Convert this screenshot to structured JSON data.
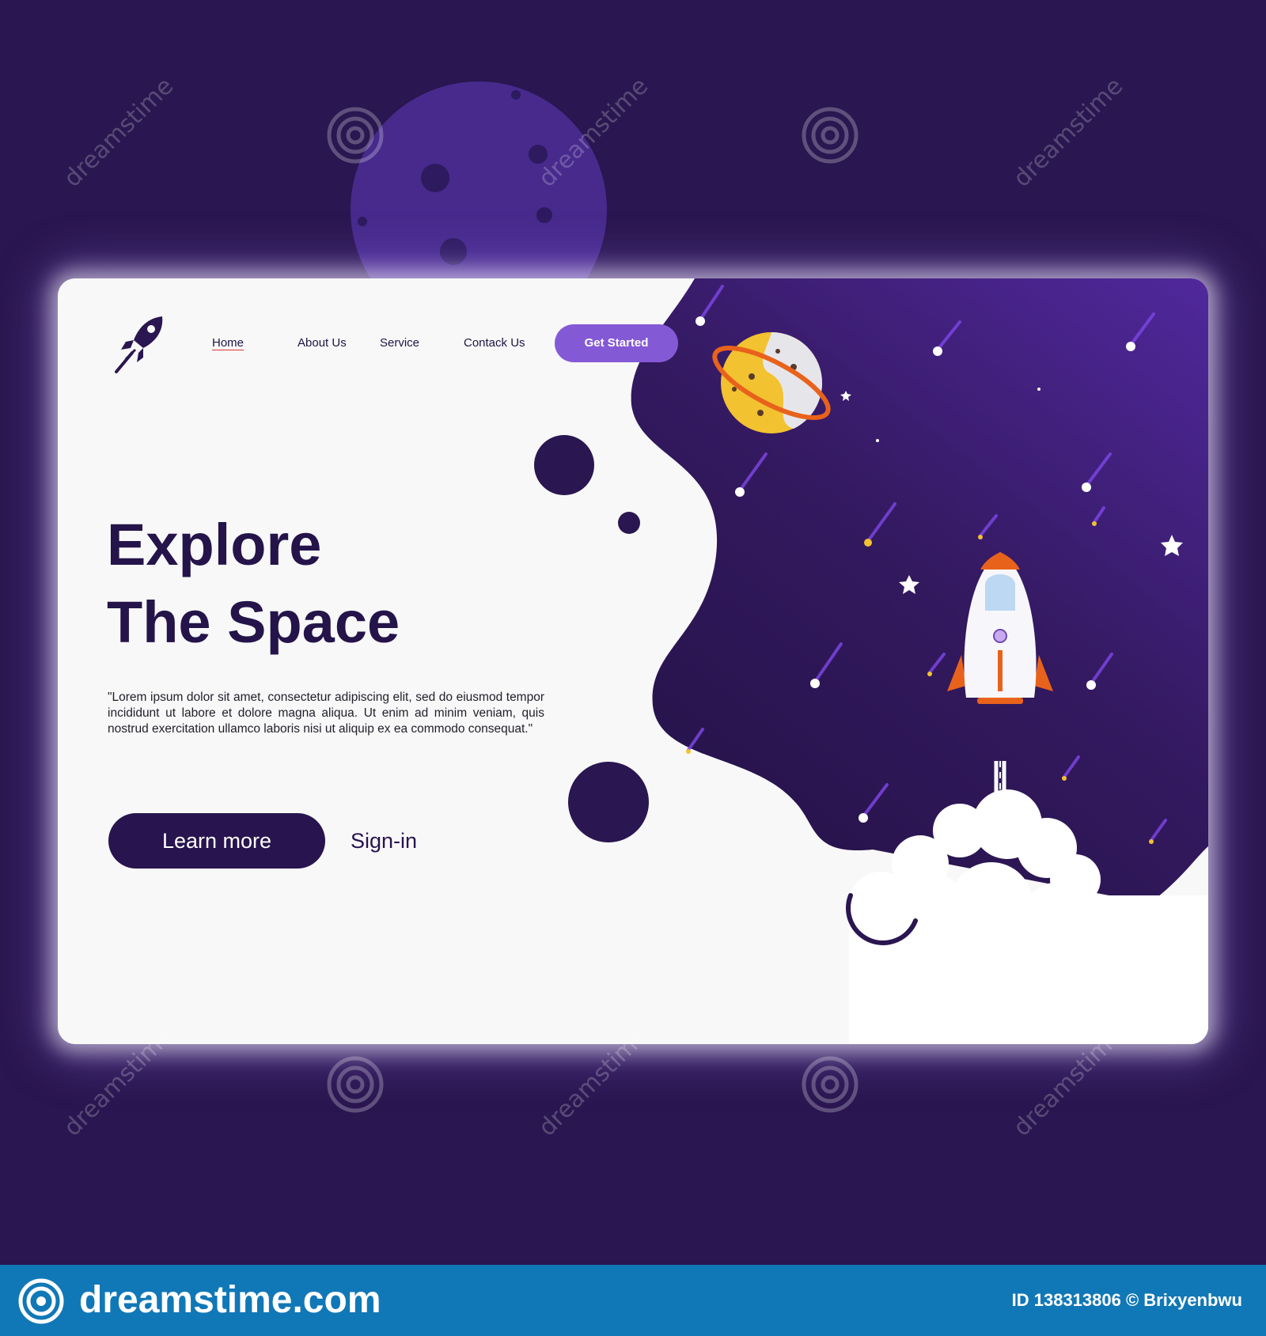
{
  "nav": {
    "items": [
      {
        "label": "Home",
        "active": true
      },
      {
        "label": "About Us",
        "active": false
      },
      {
        "label": "Service",
        "active": false
      },
      {
        "label": "Contack Us",
        "active": false
      }
    ],
    "cta_label": "Get Started"
  },
  "hero": {
    "title_line1": "Explore",
    "title_line2": "The Space",
    "body": "\"Lorem ipsum dolor sit amet, consectetur adipiscing elit, sed do eiusmod tempor incididunt ut labore et dolore magna aliqua. Ut enim ad minim veniam, quis nostrud exercitation ullamco laboris nisi ut aliquip ex ea commodo consequat.\"",
    "primary_button": "Learn more",
    "secondary_button": "Sign-in"
  },
  "watermark": {
    "text": "dreamstime"
  },
  "footer": {
    "brand": "dreamstime.com",
    "image_credit": "ID 138313806 © Brixyenbwu"
  },
  "colors": {
    "page_background": "#2a1650",
    "card_background": "#f8f8f8",
    "space_dark": "#28144e",
    "space_light": "#4e2a99",
    "accent_purple": "#8459d6",
    "footer_blue": "#1178b7",
    "planet_yellow": "#f2c230",
    "rocket_orange": "#e8621c"
  },
  "icons": [
    "rocket-logo-icon",
    "moon-icon",
    "saturn-planet-icon",
    "rocket-icon",
    "star-icon",
    "dreamstime-swirl-icon"
  ]
}
